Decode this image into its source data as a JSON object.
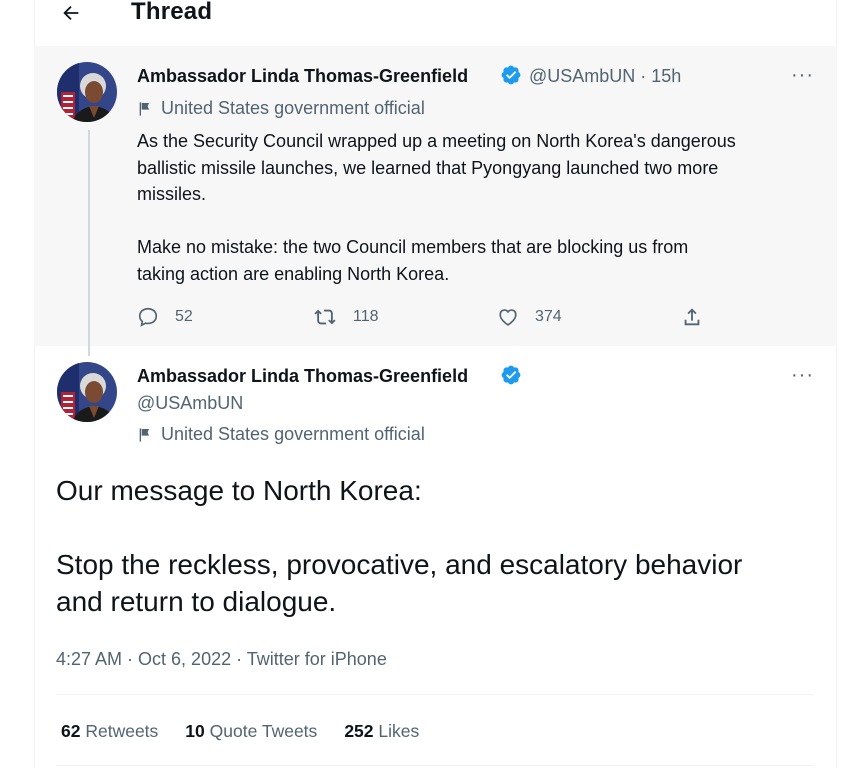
{
  "header": {
    "title": "Thread",
    "back_icon": "arrow-left-icon"
  },
  "parent_tweet": {
    "author_name": "Ambassador Linda Thomas-Greenfield",
    "handle_time": "@USAmbUN · 15h",
    "label": "United States government official",
    "text": "As the Security Council wrapped up a meeting on North Korea's dangerous\nballistic missile launches, we learned that Pyongyang launched two more\nmissiles.\n\nMake no mistake: the two Council members that are blocking us from\ntaking action are enabling North Korea.",
    "replies": "52",
    "retweets": "118",
    "likes": "374",
    "more": "···"
  },
  "main_tweet": {
    "author_name": "Ambassador Linda Thomas-Greenfield",
    "handle": "@USAmbUN",
    "label": "United States government official",
    "text": "Our message to North Korea:\n\nStop the reckless, provocative, and escalatory behavior\nand return to dialogue.",
    "meta": "4:27 AM · Oct 6, 2022 · Twitter for iPhone",
    "more": "···",
    "stats": {
      "retweets_count": "62",
      "retweets_label": "Retweets",
      "quotes_count": "10",
      "quotes_label": "Quote Tweets",
      "likes_count": "252",
      "likes_label": "Likes"
    }
  },
  "colors": {
    "verified": "#1d9bf0",
    "muted": "#536471",
    "text": "#0f1419",
    "highlight_bg": "#f7f7f8"
  }
}
